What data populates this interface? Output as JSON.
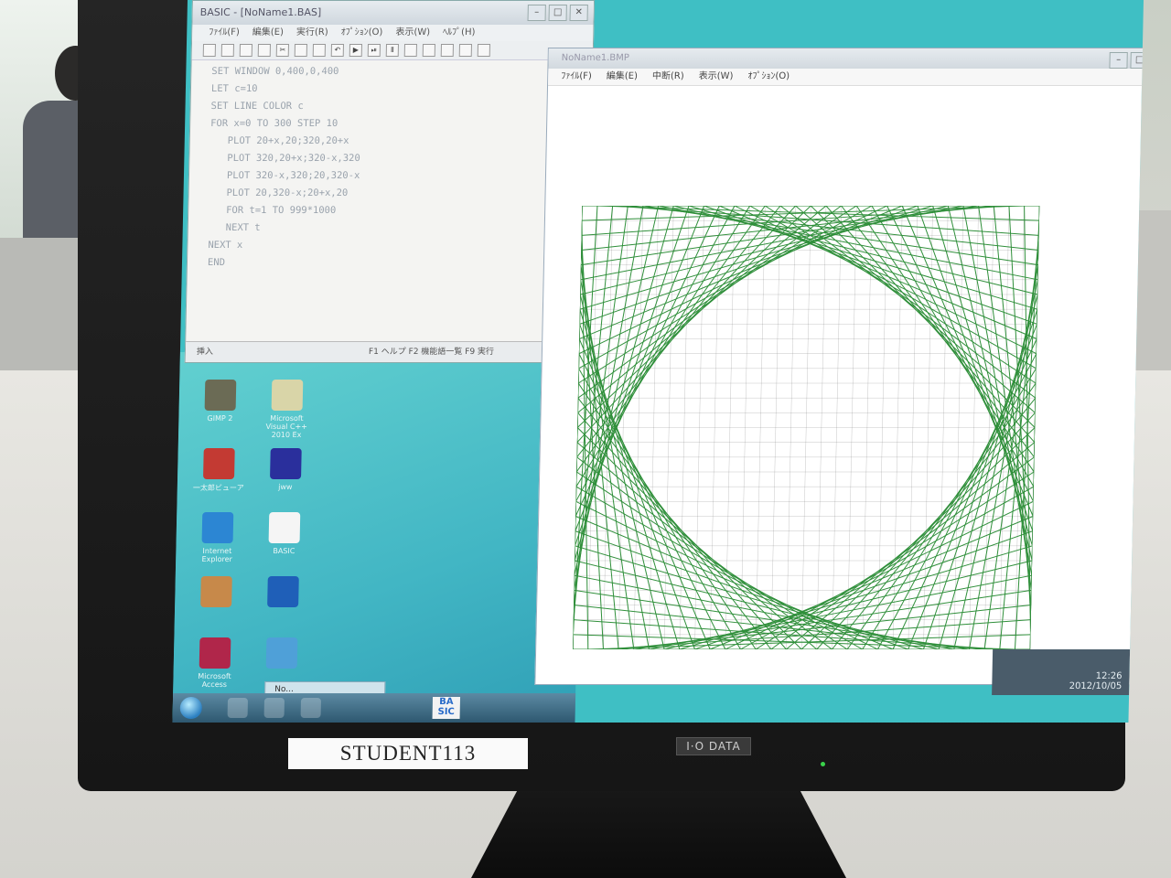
{
  "basic_window": {
    "title": "BASIC - [NoName1.BAS]",
    "menu": [
      "ﾌｧｲﾙ(F)",
      "編集(E)",
      "実行(R)",
      "ｵﾌﾟｼｮﾝ(O)",
      "表示(W)",
      "ﾍﾙﾌﾟ(H)"
    ],
    "code": "SET WINDOW 0,400,0,400\nLET c=10\nSET LINE COLOR c\nFOR x=0 TO 300 STEP 10\n   PLOT 20+x,20;320,20+x\n   PLOT 320,20+x;320-x,320\n   PLOT 320-x,320;20,320-x\n   PLOT 20,320-x;20+x,20\n   FOR t=1 TO 999*1000\n   NEXT t\nNEXT x\nEND",
    "status_mode": "挿入",
    "status_keys": "F1 ヘルプ  F2 機能語一覧  F9 実行"
  },
  "bmp_window": {
    "title": "NoName1.BMP",
    "menu": [
      "ﾌｧｲﾙ(F)",
      "編集(E)",
      "中断(R)",
      "表示(W)",
      "ｵﾌﾟｼｮﾝ(O)"
    ]
  },
  "plot": {
    "line_color": "#2f8f3a",
    "grid_color": "#777777",
    "step": 10,
    "max": 300
  },
  "desktop_icons": [
    {
      "label": "GIMP 2",
      "icon": "gimp-icon",
      "color": "#6b6b55"
    },
    {
      "label": "Microsoft Visual C++ 2010 Ex",
      "icon": "visual-cpp-icon",
      "color": "#d9d5a8"
    },
    {
      "label": "一太郎ビューア",
      "icon": "viewer-icon",
      "color": "#c33a33"
    },
    {
      "label": "jww",
      "icon": "jww-icon",
      "color": "#2a2f9c"
    },
    {
      "label": "Internet Explorer",
      "icon": "ie-icon",
      "color": "#2c86d3"
    },
    {
      "label": "BASIC",
      "icon": "basic-icon",
      "color": "#f5f5f5"
    },
    {
      "label": "",
      "icon": "app-icon",
      "color": "#c7894a"
    },
    {
      "label": "",
      "icon": "globe-app-icon",
      "color": "#1f5fb8"
    },
    {
      "label": "Microsoft Access",
      "icon": "access-icon",
      "color": "#b0264a"
    },
    {
      "label": "",
      "icon": "network-icon",
      "color": "#4fa0d8"
    }
  ],
  "taskbar": {
    "thumb": "No...",
    "basic_badge": "BA\nSIC"
  },
  "tray": {
    "time": "12:26",
    "date": "2012/10/05"
  },
  "monitor": {
    "brand": "I·O DATA",
    "label": "STUDENT113"
  }
}
